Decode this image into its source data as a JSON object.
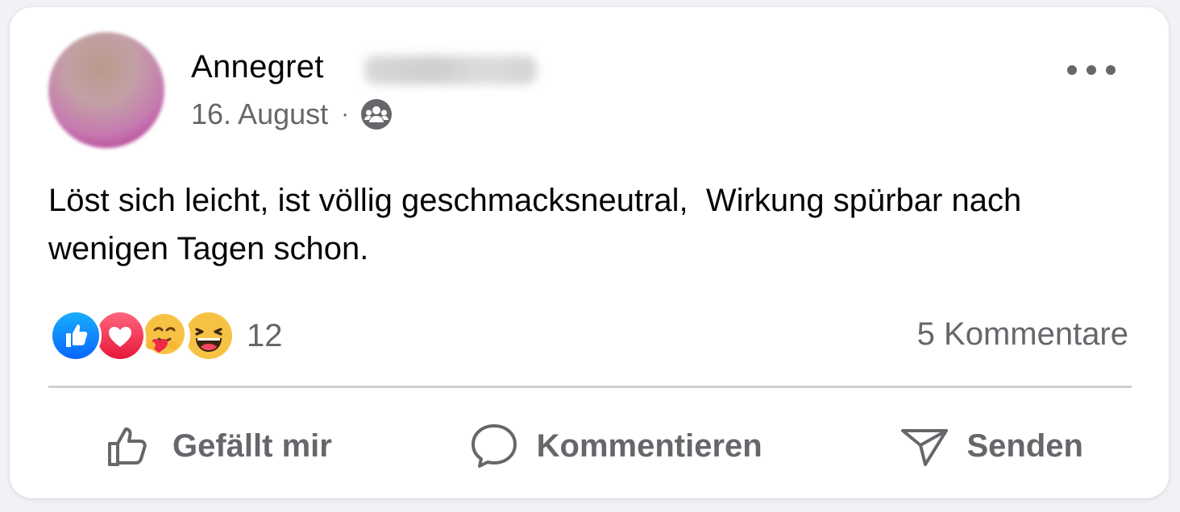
{
  "post": {
    "author_name": "Annegret",
    "date": "16. August",
    "separator": "·",
    "audience_icon": "group-audience-icon",
    "text": "Löst sich leicht, ist völlig geschmacksneutral,  Wirkung spürbar nach wenigen Tagen schon."
  },
  "reactions": {
    "icons": [
      "like-reaction-icon",
      "love-reaction-icon",
      "care-reaction-icon",
      "haha-reaction-icon"
    ],
    "count": "12",
    "comments_label": "5 Kommentare"
  },
  "actions": {
    "like_label": "Gefällt mir",
    "comment_label": "Kommentieren",
    "send_label": "Senden"
  },
  "colors": {
    "text_primary": "#050505",
    "text_secondary": "#65676b",
    "like_blue": "#1877f2",
    "love_red": "#f33e58",
    "divider": "#ced0d4"
  }
}
